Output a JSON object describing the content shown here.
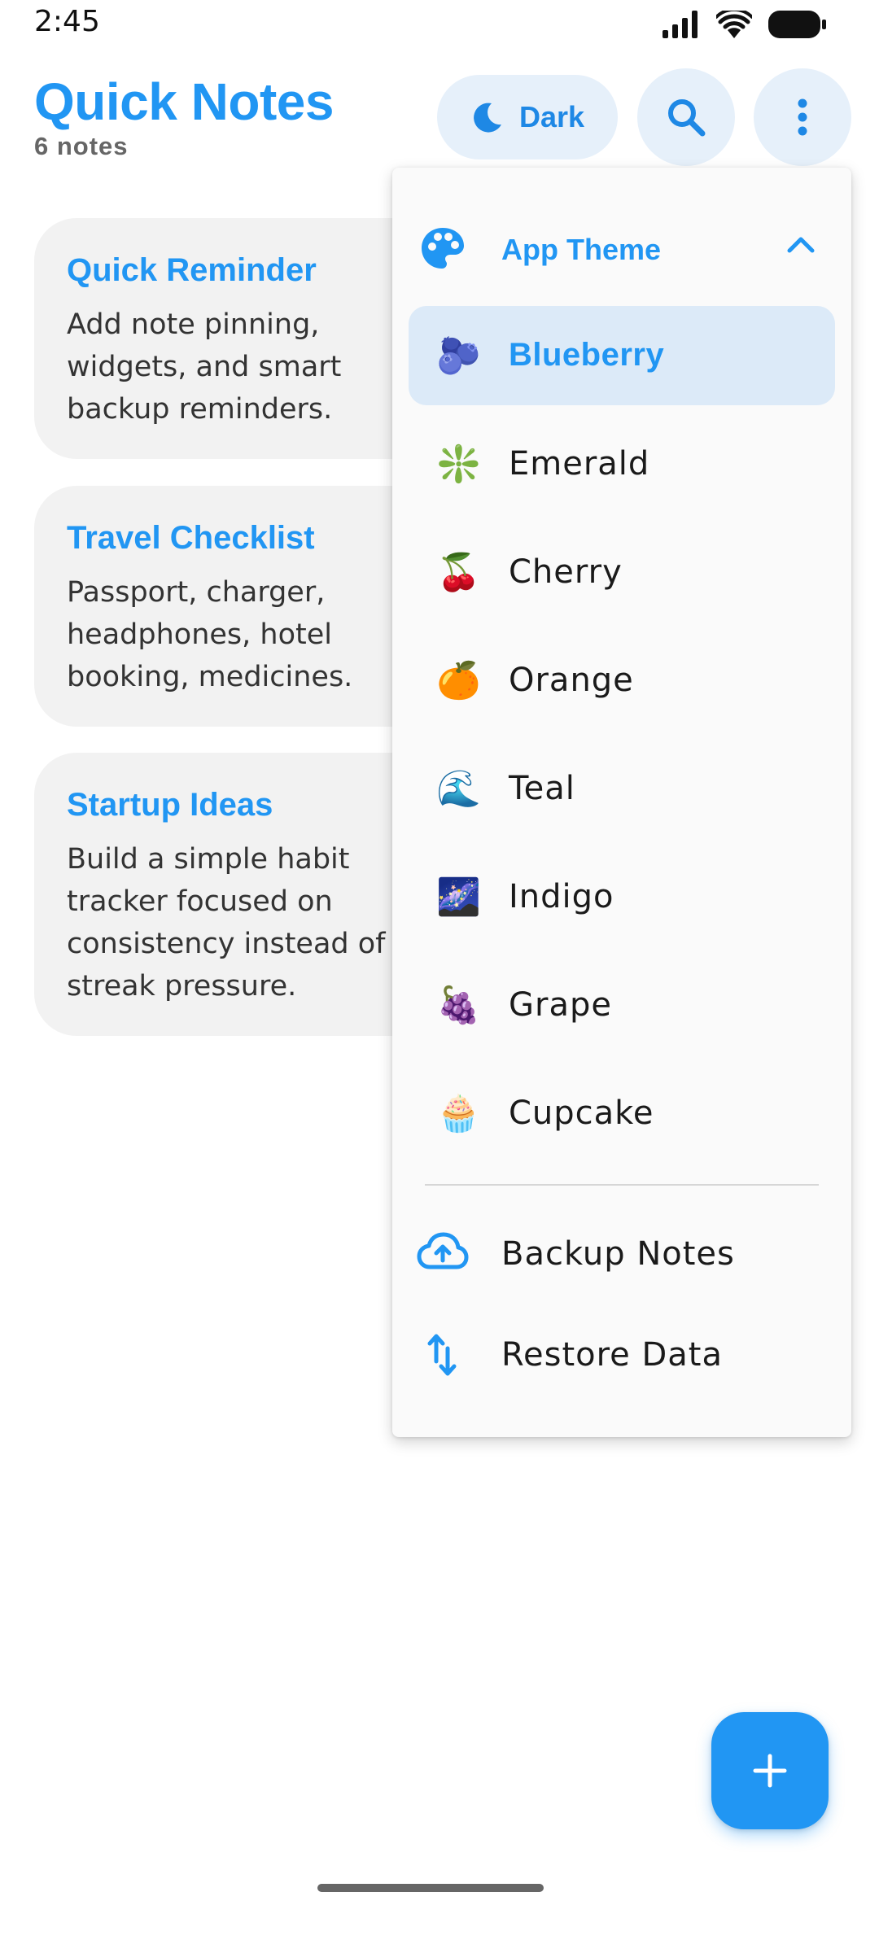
{
  "status_bar": {
    "time": "2:45",
    "icons": [
      "signal-icon",
      "wifi-icon",
      "battery-icon"
    ]
  },
  "header": {
    "title": "Quick Notes",
    "count": "6 notes",
    "dark_toggle_label": "Dark",
    "icons": [
      "moon-icon",
      "search-icon",
      "more-vert-icon"
    ]
  },
  "notes": [
    {
      "title": "Quick Reminder",
      "body_lines": [
        "Add note pinning,",
        "widgets, and smart",
        "backup reminders."
      ]
    },
    {
      "title": "Travel Checklist",
      "body_lines": [
        "Passport, charger,",
        "headphones, hotel",
        "booking, medicines."
      ]
    },
    {
      "title": "Startup Ideas",
      "body_lines": [
        "Build a simple habit",
        "tracker focused on",
        "consistency instead of",
        "streak pressure."
      ]
    }
  ],
  "menu": {
    "theme_header": "App Theme",
    "theme_header_icon": "palette-icon",
    "themes": [
      {
        "label": "Blueberry",
        "emoji": "🫐",
        "selected": true
      },
      {
        "label": "Emerald",
        "emoji": "❇️",
        "selected": false
      },
      {
        "label": "Cherry",
        "emoji": "🍒",
        "selected": false
      },
      {
        "label": "Orange",
        "emoji": "🍊",
        "selected": false
      },
      {
        "label": "Teal",
        "emoji": "🌊",
        "selected": false
      },
      {
        "label": "Indigo",
        "emoji": "🌌",
        "selected": false
      },
      {
        "label": "Grape",
        "emoji": "🍇",
        "selected": false
      },
      {
        "label": "Cupcake",
        "emoji": "🧁",
        "selected": false
      }
    ],
    "actions": [
      {
        "label": "Backup Notes",
        "icon": "cloud-upload-icon"
      },
      {
        "label": "Restore Data",
        "icon": "swap-vert-icon"
      }
    ]
  },
  "fab": {
    "icon": "plus-icon"
  },
  "colors": {
    "accent": "#2196F3",
    "accent_light": "#E6F0FA",
    "selected_bg": "#DCEAF8",
    "card_bg": "#F2F2F2"
  }
}
